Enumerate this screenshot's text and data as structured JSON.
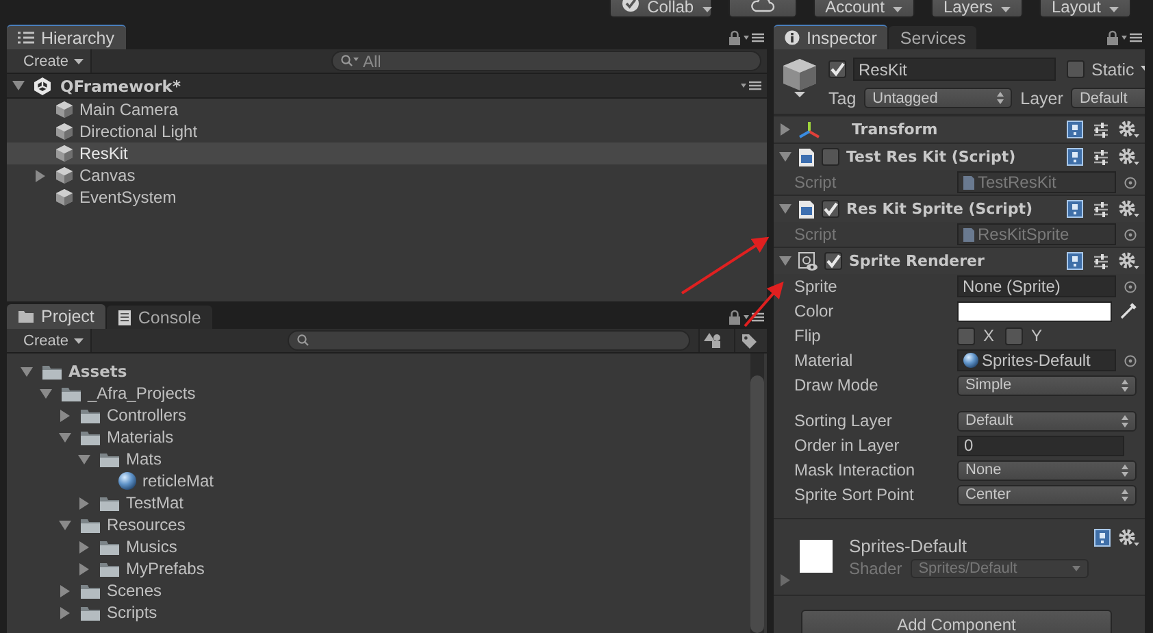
{
  "toolbar": {
    "buttons": [
      {
        "kind": "collab",
        "label": "Collab"
      },
      {
        "kind": "cloud"
      },
      {
        "kind": "menu",
        "label": "Account"
      },
      {
        "kind": "menu",
        "label": "Layers"
      },
      {
        "kind": "menu",
        "label": "Layout"
      }
    ]
  },
  "hierarchy": {
    "tab": "Hierarchy",
    "create": "Create",
    "search_placeholder": "All",
    "scene": {
      "name": "QFramework*",
      "expanded": true,
      "children": [
        {
          "label": "Main Camera",
          "selected": false
        },
        {
          "label": "Directional Light",
          "selected": false
        },
        {
          "label": "ResKit",
          "selected": true
        },
        {
          "label": "Canvas",
          "selected": false,
          "expanded": false
        },
        {
          "label": "EventSystem",
          "selected": false
        }
      ]
    }
  },
  "project": {
    "tabs": [
      {
        "label": "Project",
        "kind": "project",
        "selected": true
      },
      {
        "label": "Console",
        "kind": "console",
        "selected": false
      }
    ],
    "create": "Create",
    "tree": [
      {
        "label": "Assets",
        "kind": "folder",
        "expanded": true,
        "children": [
          {
            "label": "_Afra_Projects",
            "kind": "folder",
            "expanded": true,
            "children": [
              {
                "label": "Controllers",
                "kind": "folder",
                "expanded": false
              },
              {
                "label": "Materials",
                "kind": "folder",
                "expanded": true,
                "children": [
                  {
                    "label": "Mats",
                    "kind": "folder",
                    "expanded": true,
                    "children": [
                      {
                        "label": "reticleMat",
                        "kind": "material"
                      }
                    ]
                  },
                  {
                    "label": "TestMat",
                    "kind": "folder",
                    "expanded": false
                  }
                ]
              },
              {
                "label": "Resources",
                "kind": "folder",
                "expanded": true,
                "children": [
                  {
                    "label": "Musics",
                    "kind": "folder",
                    "expanded": false
                  },
                  {
                    "label": "MyPrefabs",
                    "kind": "folder",
                    "expanded": false
                  }
                ]
              },
              {
                "label": "Scenes",
                "kind": "folder",
                "expanded": false
              },
              {
                "label": "Scripts",
                "kind": "folder",
                "expanded": false
              }
            ]
          }
        ]
      }
    ]
  },
  "inspector": {
    "tabs": [
      {
        "label": "Inspector",
        "kind": "inspector",
        "selected": true
      },
      {
        "label": "Services",
        "kind": "services",
        "selected": false
      }
    ],
    "object": {
      "active": true,
      "name": "ResKit",
      "static": false,
      "static_label": "Static",
      "tag_label": "Tag",
      "tag": "Untagged",
      "layer_label": "Layer",
      "layer": "Default"
    },
    "components": [
      {
        "title": "Transform",
        "kind": "transform",
        "expanded": false
      },
      {
        "title": "Test Res Kit (Script)",
        "kind": "script",
        "expanded": true,
        "enabled": false,
        "fields": [
          {
            "label": "Script",
            "kind": "script_ref",
            "value": "TestResKit",
            "disabled": true
          }
        ]
      },
      {
        "title": "Res Kit Sprite (Script)",
        "kind": "script",
        "expanded": true,
        "enabled": true,
        "fields": [
          {
            "label": "Script",
            "kind": "script_ref",
            "value": "ResKitSprite",
            "disabled": true
          }
        ]
      },
      {
        "title": "Sprite Renderer",
        "kind": "sprite",
        "expanded": true,
        "enabled": true,
        "fields": [
          {
            "label": "Sprite",
            "kind": "object",
            "value": "None (Sprite)",
            "disabled": false
          },
          {
            "label": "Color",
            "kind": "color",
            "color": "#ffffff"
          },
          {
            "label": "Flip",
            "kind": "flip",
            "options": [
              {
                "label": "X",
                "checked": false
              },
              {
                "label": "Y",
                "checked": false
              }
            ]
          },
          {
            "label": "Material",
            "kind": "material_ref",
            "value": "Sprites-Default",
            "disabled": false
          },
          {
            "label": "Draw Mode",
            "kind": "popup",
            "value": "Simple"
          },
          {
            "kind": "space"
          },
          {
            "label": "Sorting Layer",
            "kind": "popup",
            "value": "Default"
          },
          {
            "label": "Order in Layer",
            "kind": "text",
            "value": "0"
          },
          {
            "label": "Mask Interaction",
            "kind": "popup",
            "value": "None"
          },
          {
            "label": "Sprite Sort Point",
            "kind": "popup",
            "value": "Center"
          }
        ]
      }
    ],
    "material": {
      "name": "Sprites-Default",
      "shader_label": "Shader",
      "shader": "Sprites/Default"
    },
    "add_button": "Add Component"
  }
}
